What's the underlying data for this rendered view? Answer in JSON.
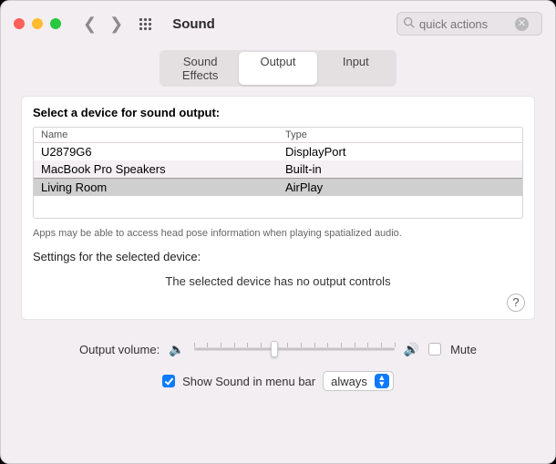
{
  "window": {
    "title": "Sound"
  },
  "search": {
    "placeholder": "quick actions"
  },
  "tabs": {
    "items": [
      "Sound Effects",
      "Output",
      "Input"
    ],
    "active": 1
  },
  "panel": {
    "heading": "Select a device for sound output:",
    "columns": {
      "name": "Name",
      "type": "Type"
    },
    "devices": [
      {
        "name": "U2879G6",
        "type": "DisplayPort"
      },
      {
        "name": "MacBook Pro Speakers",
        "type": "Built-in"
      },
      {
        "name": "Living Room",
        "type": "AirPlay"
      }
    ],
    "selected_index": 2,
    "note": "Apps may be able to access head pose information when playing spatialized audio.",
    "settings_label": "Settings for the selected device:",
    "no_controls": "The selected device has no output controls",
    "help": "?"
  },
  "volume": {
    "label": "Output volume:",
    "value_percent": 40,
    "mute_label": "Mute",
    "muted": false
  },
  "menubar": {
    "checked": true,
    "label": "Show Sound in menu bar",
    "popup_value": "always"
  }
}
